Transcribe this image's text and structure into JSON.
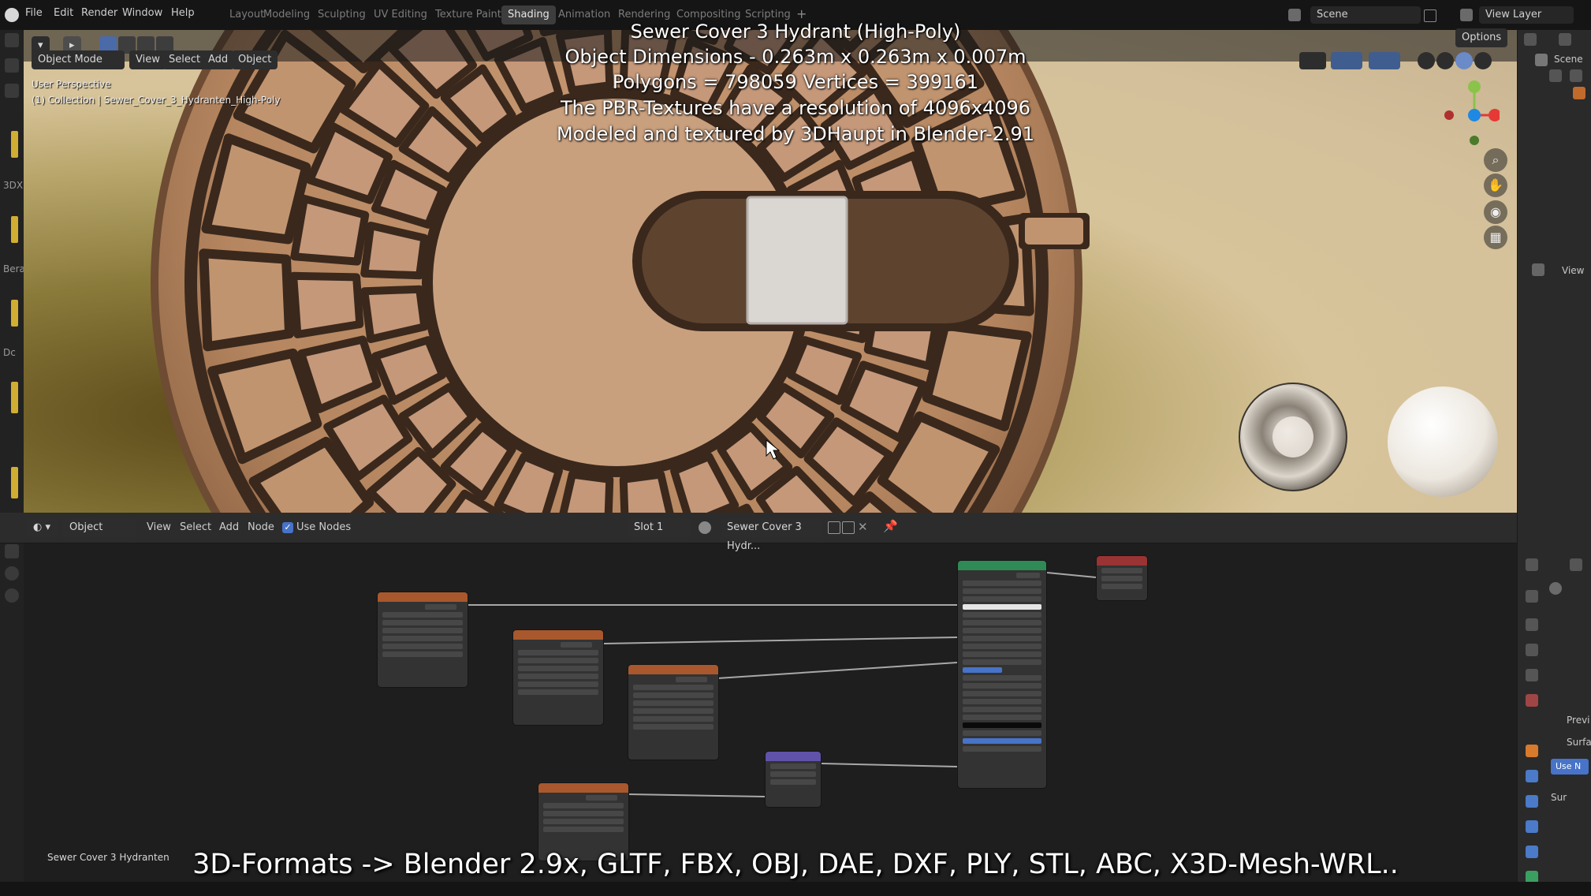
{
  "topbar": {
    "menus": [
      "File",
      "Edit",
      "Render",
      "Window",
      "Help"
    ],
    "workspaces": [
      "Layout",
      "Modeling",
      "Sculpting",
      "UV Editing",
      "Texture Paint",
      "Shading",
      "Animation",
      "Rendering",
      "Compositing",
      "Scripting"
    ],
    "active_workspace": "Shading",
    "scene_label": "Scene",
    "view_layer_label": "View Layer"
  },
  "viewport": {
    "mode": "Object Mode",
    "menus": [
      "View",
      "Select",
      "Add",
      "Object"
    ],
    "options_label": "Options",
    "perspective": "User Perspective",
    "collection_info": "(1) Collection | Sewer_Cover_3_Hydranten_High-Poly"
  },
  "overlay": {
    "title": "Sewer Cover 3 Hydrant (High-Poly)",
    "dimensions": "Object Dimensions - 0.263m x 0.263m x 0.007m",
    "poly_stats": "Polygons = 798059  Vertices = 399161",
    "textures": "The PBR-Textures have a resolution of 4096x4096",
    "credit": "Modeled and textured by 3DHaupt in Blender-2.91"
  },
  "node_editor": {
    "object_label": "Object",
    "menus": [
      "View",
      "Select",
      "Add",
      "Node"
    ],
    "use_nodes_label": "Use Nodes",
    "slot_label": "Slot 1",
    "material_name": "Sewer Cover 3 Hydr...",
    "bottom_label": "Sewer Cover 3 Hydranten"
  },
  "right_panel": {
    "scene_label": "Scene",
    "view_label": "View",
    "previ_label": "Previ",
    "surfac_label": "Surfac",
    "use_label": "Use N",
    "sur_label": "Sur"
  },
  "left_toolbar_labels": [
    "3DX",
    "Bera",
    "Dc"
  ],
  "caption": "3D-Formats -> Blender 2.9x, GLTF, FBX, OBJ, DAE, DXF, PLY, STL, ABC, X3D-Mesh-WRL..",
  "colors": {
    "cover": "#b98a64",
    "accent_yellow": "#d1ae32",
    "node_orange": "#a8582c",
    "node_green": "#2f8a55",
    "node_red": "#9a3333",
    "node_purple": "#6052a8"
  }
}
